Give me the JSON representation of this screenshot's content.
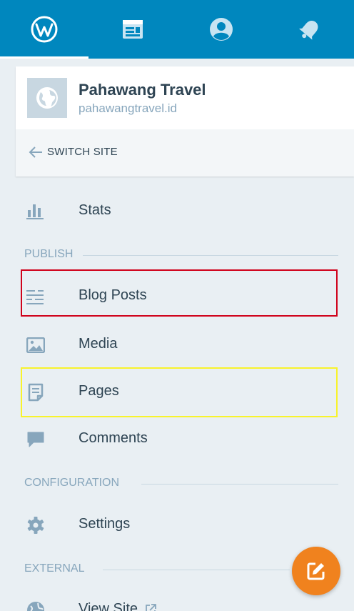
{
  "topbar": {
    "tabs": [
      {
        "name": "my-sites",
        "icon": "wordpress-logo-icon",
        "active": true
      },
      {
        "name": "reader",
        "icon": "reader-icon",
        "active": false
      },
      {
        "name": "me",
        "icon": "user-circle-icon",
        "active": false
      },
      {
        "name": "notifications",
        "icon": "bell-icon",
        "active": false
      }
    ],
    "color": "#0087be"
  },
  "site": {
    "name": "Pahawang Travel",
    "url": "pahawangtravel.id",
    "switch_label": "SWITCH SITE"
  },
  "menu": {
    "stats": "Stats",
    "publish_header": "PUBLISH",
    "blog_posts": "Blog Posts",
    "media": "Media",
    "pages": "Pages",
    "comments": "Comments",
    "configuration_header": "CONFIGURATION",
    "settings": "Settings",
    "external_header": "EXTERNAL",
    "view_site": "View Site"
  },
  "highlights": {
    "red": "#d0021b",
    "yellow": "#f8f32b"
  },
  "fab": {
    "icon": "edit-icon",
    "color": "#f0821e"
  }
}
